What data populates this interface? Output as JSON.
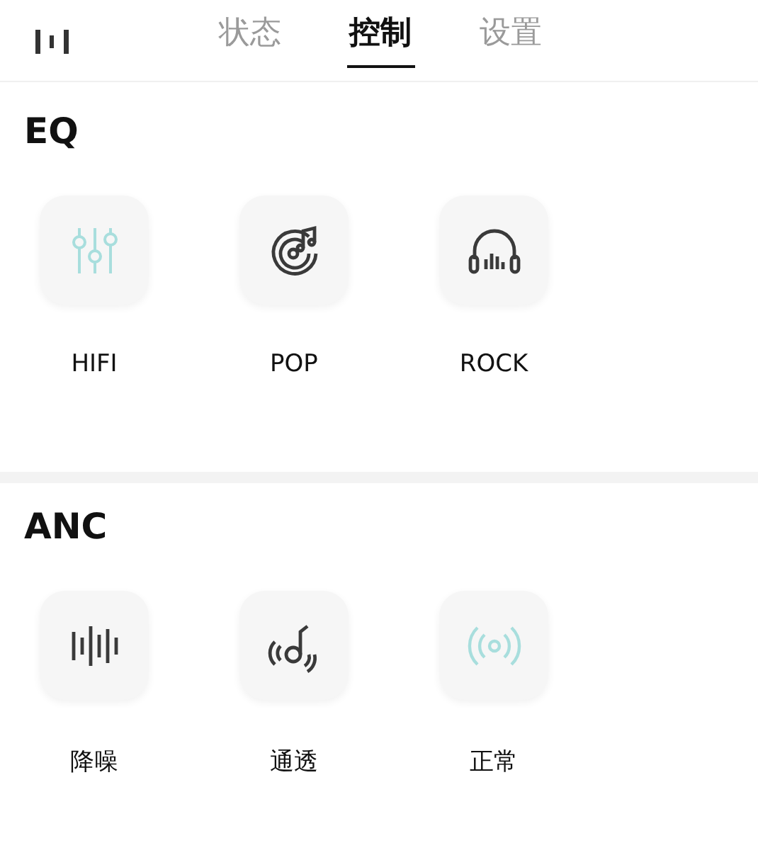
{
  "tabs": [
    {
      "label": "状态",
      "selected": false
    },
    {
      "label": "控制",
      "selected": true
    },
    {
      "label": "设置",
      "selected": false
    }
  ],
  "sections": [
    {
      "title": "EQ",
      "options": [
        {
          "label": "HIFI",
          "selected": true
        },
        {
          "label": "POP",
          "selected": false
        },
        {
          "label": "ROCK",
          "selected": false
        }
      ]
    },
    {
      "title": "ANC",
      "options": [
        {
          "label": "降噪",
          "selected": false
        },
        {
          "label": "通透",
          "selected": false
        },
        {
          "label": "正常",
          "selected": true
        }
      ]
    }
  ]
}
